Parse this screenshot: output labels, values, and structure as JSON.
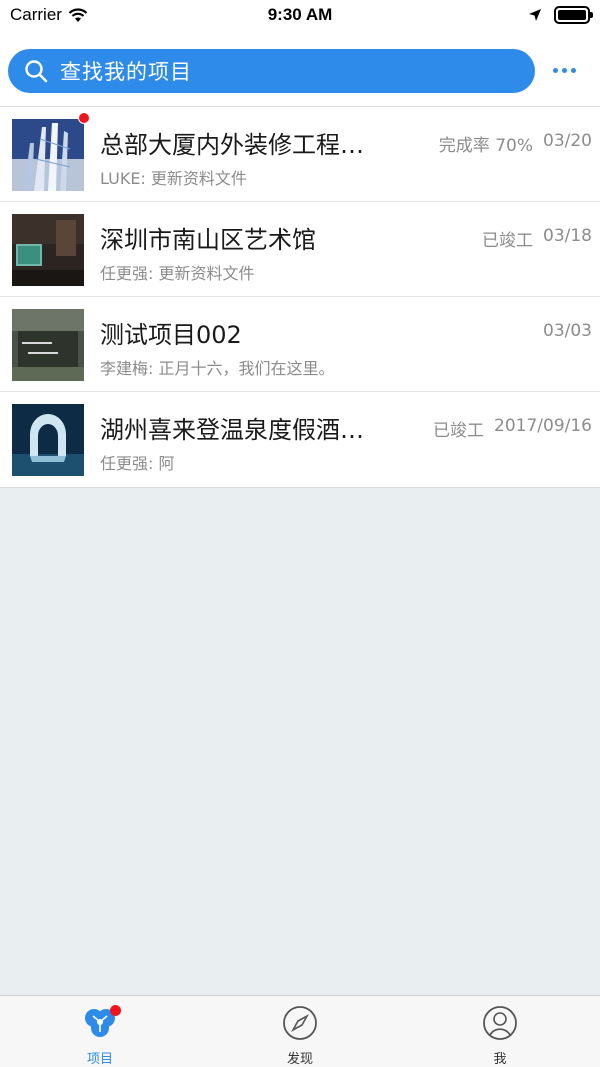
{
  "status_bar": {
    "carrier": "Carrier",
    "time": "9:30 AM"
  },
  "search": {
    "placeholder": "查找我的项目"
  },
  "projects": [
    {
      "title": "总部大厦内外装修工程…",
      "status": "完成率 70%",
      "date": "03/20",
      "subtitle": "LUKE: 更新资料文件",
      "unread": true
    },
    {
      "title": "深圳市南山区艺术馆",
      "status": "已竣工",
      "date": "03/18",
      "subtitle": "任更强: 更新资料文件",
      "unread": false
    },
    {
      "title": "测试项目002",
      "status": "",
      "date": "03/03",
      "subtitle": "李建梅: 正月十六，我们在这里。",
      "unread": false
    },
    {
      "title": "湖州喜来登温泉度假酒…",
      "status": "已竣工",
      "date": "2017/09/16",
      "subtitle": "任更强: 阿",
      "unread": false
    }
  ],
  "tabs": [
    {
      "label": "项目",
      "icon": "projects-icon",
      "active": true,
      "badge": true
    },
    {
      "label": "发现",
      "icon": "compass-icon",
      "active": false,
      "badge": false
    },
    {
      "label": "我",
      "icon": "user-icon",
      "active": false,
      "badge": false
    }
  ],
  "colors": {
    "accent": "#2f8bea",
    "badge": "#f0161b",
    "background": "#e9eef0"
  }
}
